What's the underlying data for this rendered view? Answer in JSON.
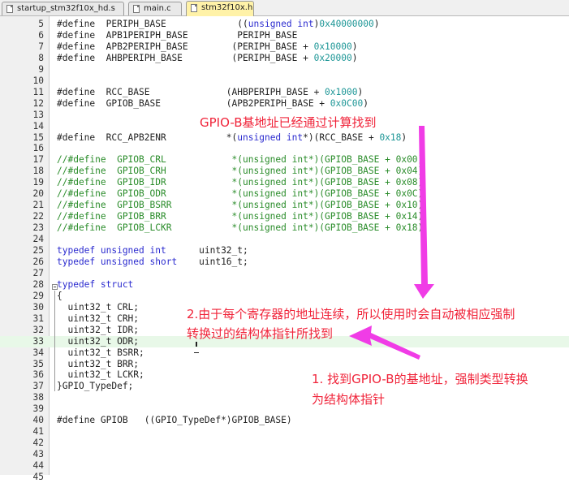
{
  "tabs": [
    {
      "label": "startup_stm32f10x_hd.s",
      "active": false
    },
    {
      "label": "main.c",
      "active": false
    },
    {
      "label": "stm32f10x.h",
      "active": true
    }
  ],
  "lines": [
    {
      "n": "5",
      "segs": [
        [
          "pp",
          "#define  PERIPH_BASE             ((unsigned int)0x40000000)"
        ]
      ]
    },
    {
      "n": "6",
      "segs": [
        [
          "pp",
          "#define  APB1PERIPH_BASE         PERIPH_BASE"
        ]
      ]
    },
    {
      "n": "7",
      "segs": [
        [
          "pp",
          "#define  APB2PERIPH_BASE        (PERIPH_BASE + 0x10000)"
        ]
      ]
    },
    {
      "n": "8",
      "segs": [
        [
          "pp",
          "#define  AHBPERIPH_BASE         (PERIPH_BASE + 0x20000)"
        ]
      ]
    },
    {
      "n": "9",
      "segs": []
    },
    {
      "n": "10",
      "segs": []
    },
    {
      "n": "11",
      "segs": [
        [
          "pp",
          "#define  RCC_BASE              (AHBPERIPH_BASE + 0x1000)"
        ]
      ]
    },
    {
      "n": "12",
      "segs": [
        [
          "pp",
          "#define  GPIOB_BASE            (APB2PERIPH_BASE + 0x0C00)"
        ]
      ]
    },
    {
      "n": "13",
      "segs": []
    },
    {
      "n": "14",
      "segs": []
    },
    {
      "n": "15",
      "segs": [
        [
          "pp",
          "#define  RCC_APB2ENR           *(unsigned int*)(RCC_BASE + 0x18)"
        ]
      ]
    },
    {
      "n": "16",
      "segs": []
    },
    {
      "n": "17",
      "segs": [
        [
          "cm",
          "//#define  GPIOB_CRL            *(unsigned int*)(GPIOB_BASE + 0x00)"
        ]
      ]
    },
    {
      "n": "18",
      "segs": [
        [
          "cm",
          "//#define  GPIOB_CRH            *(unsigned int*)(GPIOB_BASE + 0x04)"
        ]
      ]
    },
    {
      "n": "19",
      "segs": [
        [
          "cm",
          "//#define  GPIOB_IDR            *(unsigned int*)(GPIOB_BASE + 0x08)"
        ]
      ]
    },
    {
      "n": "20",
      "segs": [
        [
          "cm",
          "//#define  GPIOB_ODR            *(unsigned int*)(GPIOB_BASE + 0x0C)"
        ]
      ]
    },
    {
      "n": "21",
      "segs": [
        [
          "cm",
          "//#define  GPIOB_BSRR           *(unsigned int*)(GPIOB_BASE + 0x10)"
        ]
      ]
    },
    {
      "n": "22",
      "segs": [
        [
          "cm",
          "//#define  GPIOB_BRR            *(unsigned int*)(GPIOB_BASE + 0x14)"
        ]
      ]
    },
    {
      "n": "23",
      "segs": [
        [
          "cm",
          "//#define  GPIOB_LCKR           *(unsigned int*)(GPIOB_BASE + 0x18)"
        ]
      ]
    },
    {
      "n": "24",
      "segs": []
    },
    {
      "n": "25",
      "segs": [
        [
          "kw",
          "typedef unsigned int"
        ],
        [
          "tx",
          "      uint32_t;"
        ]
      ]
    },
    {
      "n": "26",
      "segs": [
        [
          "kw",
          "typedef unsigned short"
        ],
        [
          "tx",
          "    uint16_t;"
        ]
      ]
    },
    {
      "n": "27",
      "segs": []
    },
    {
      "n": "28",
      "segs": [
        [
          "kw",
          "typedef struct"
        ]
      ]
    },
    {
      "n": "29",
      "segs": [
        [
          "tx",
          "{"
        ]
      ]
    },
    {
      "n": "30",
      "segs": [
        [
          "tx",
          "  uint32_t CRL;"
        ]
      ]
    },
    {
      "n": "31",
      "segs": [
        [
          "tx",
          "  uint32_t CRH;"
        ]
      ]
    },
    {
      "n": "32",
      "segs": [
        [
          "tx",
          "  uint32_t IDR;"
        ]
      ]
    },
    {
      "n": "33",
      "segs": [
        [
          "tx",
          "  uint32_t ODR;"
        ]
      ]
    },
    {
      "n": "34",
      "segs": [
        [
          "tx",
          "  uint32_t BSRR;"
        ]
      ]
    },
    {
      "n": "35",
      "segs": [
        [
          "tx",
          "  uint32_t BRR;"
        ]
      ]
    },
    {
      "n": "36",
      "segs": [
        [
          "tx",
          "  uint32_t LCKR;"
        ]
      ]
    },
    {
      "n": "37",
      "segs": [
        [
          "tx",
          "}GPIO_TypeDef;"
        ]
      ]
    },
    {
      "n": "38",
      "segs": []
    },
    {
      "n": "39",
      "segs": []
    },
    {
      "n": "40",
      "segs": [
        [
          "pp",
          "#define GPIOB   ((GPIO_TypeDef*)GPIOB_BASE)"
        ]
      ]
    },
    {
      "n": "41",
      "segs": []
    },
    {
      "n": "42",
      "segs": []
    },
    {
      "n": "43",
      "segs": []
    },
    {
      "n": "44",
      "segs": []
    },
    {
      "n": "45",
      "segs": []
    }
  ],
  "current_line": "33",
  "annotations": {
    "note_gpiob": "GPIO-B基地址已经通过计算找到",
    "note_2_line1": "2.由于每个寄存器的地址连续，所以使用时会自动被相应强制",
    "note_2_line2": "转换过的结构体指针所找到",
    "note_1_line1": "1. 找到GPIO-B的基地址，强制类型转换",
    "note_1_line2": "为结构体指针"
  },
  "colors": {
    "keyword": "#2b2bcf",
    "number": "#1d9696",
    "comment": "#2a8c2a",
    "annotation": "#f0243a",
    "arrow": "#f03ce6",
    "active_tab": "#fff2a8",
    "current_line": "#e8f8e8"
  }
}
